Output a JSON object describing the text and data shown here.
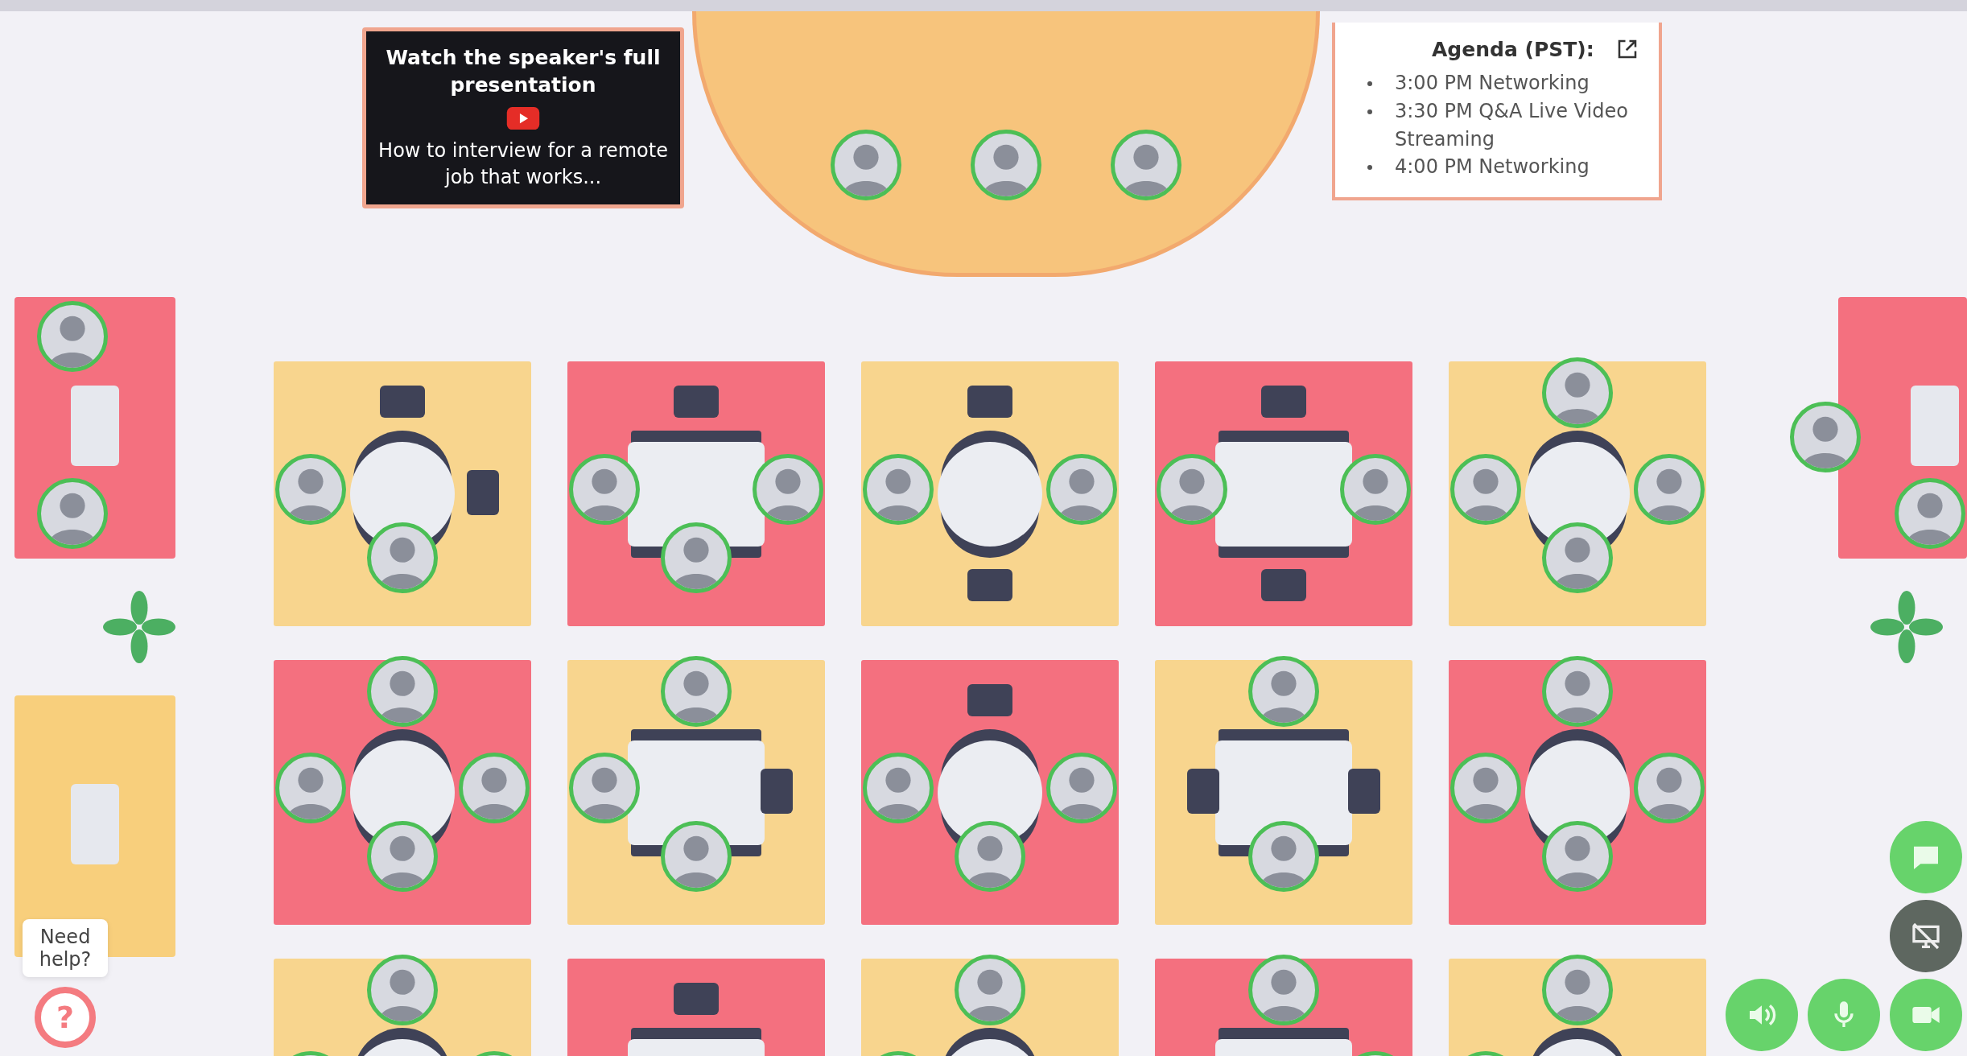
{
  "video_card": {
    "title": "Watch the speaker's full presentation",
    "caption": "How to interview for a remote job that works..."
  },
  "stage": {
    "seats": [
      {
        "occupied": true
      },
      {
        "occupied": true
      },
      {
        "occupied": true
      }
    ]
  },
  "agenda": {
    "title": "Agenda (PST):",
    "items": [
      "3:00 PM Networking",
      "3:30 PM Q&A Live Video Streaming",
      "4:00 PM Networking"
    ]
  },
  "left_rooms": [
    {
      "color": "#f4707f",
      "seats": [
        {
          "occupied": true
        },
        {
          "occupied": true
        }
      ]
    },
    {
      "color": "#f8cf7c"
    }
  ],
  "right_rooms": [
    {
      "color": "#f4707f",
      "seats": [
        {
          "occupied": true
        },
        {
          "occupied": true
        }
      ]
    }
  ],
  "tables": [
    {
      "kind": "round",
      "color": "#f8d58e",
      "seats": {
        "top": false,
        "left": true,
        "right": false,
        "bottom": true
      }
    },
    {
      "kind": "rect",
      "color": "#f4707f",
      "seats": {
        "top": false,
        "left": true,
        "right": true,
        "bottom": true
      }
    },
    {
      "kind": "round",
      "color": "#f8d58e",
      "seats": {
        "top": false,
        "left": true,
        "right": true,
        "bottom": false
      }
    },
    {
      "kind": "rect",
      "color": "#f4707f",
      "seats": {
        "top": false,
        "left": true,
        "right": true,
        "bottom": false
      }
    },
    {
      "kind": "round",
      "color": "#f8d58e",
      "seats": {
        "top": true,
        "left": true,
        "right": true,
        "bottom": true
      }
    },
    {
      "kind": "round",
      "color": "#f4707f",
      "seats": {
        "top": true,
        "left": true,
        "right": true,
        "bottom": true
      }
    },
    {
      "kind": "rect",
      "color": "#f8d58e",
      "seats": {
        "top": true,
        "left": true,
        "right": false,
        "bottom": true
      }
    },
    {
      "kind": "round",
      "color": "#f4707f",
      "seats": {
        "top": false,
        "left": true,
        "right": true,
        "bottom": true
      }
    },
    {
      "kind": "rect",
      "color": "#f8d58e",
      "seats": {
        "top": true,
        "left": false,
        "right": false,
        "bottom": true
      }
    },
    {
      "kind": "round",
      "color": "#f4707f",
      "seats": {
        "top": true,
        "left": true,
        "right": true,
        "bottom": true
      }
    },
    {
      "kind": "round",
      "color": "#f8d58e",
      "seats": {
        "top": true,
        "left": true,
        "right": true
      }
    },
    {
      "kind": "rect",
      "color": "#f4707f",
      "seats": {
        "top": false
      }
    },
    {
      "kind": "round",
      "color": "#f8d58e",
      "seats": {
        "top": true,
        "left": true
      }
    },
    {
      "kind": "rect",
      "color": "#f4707f",
      "seats": {
        "top": true,
        "right": true
      }
    },
    {
      "kind": "round",
      "color": "#f8d58e",
      "seats": {
        "top": true,
        "left": true
      }
    }
  ],
  "help": {
    "tooltip": "Need help?",
    "glyph": "?"
  },
  "controls": [
    {
      "kind": "chat",
      "on": true
    },
    {
      "kind": "screen-share",
      "on": false
    },
    {
      "kind": "speaker",
      "on": true
    },
    {
      "kind": "mic",
      "on": true
    },
    {
      "kind": "camera",
      "on": true
    }
  ]
}
